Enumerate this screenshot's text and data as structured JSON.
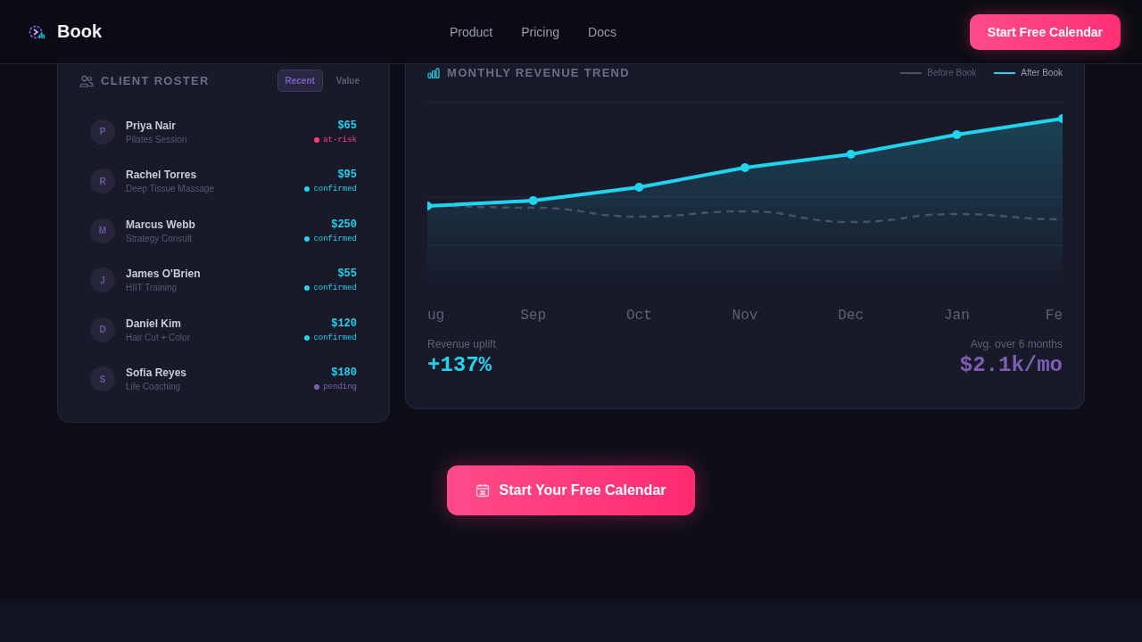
{
  "brand": {
    "name": "Book"
  },
  "nav": [
    {
      "label": "Product"
    },
    {
      "label": "Pricing"
    },
    {
      "label": "Docs"
    }
  ],
  "header_cta": "Start Free Calendar",
  "roster": {
    "title": "CLIENT ROSTER",
    "sort_tabs": [
      {
        "label": "Recent",
        "selected": true
      },
      {
        "label": "Value",
        "selected": false
      }
    ],
    "clients": [
      {
        "initial": "P",
        "name": "Priya Nair",
        "service": "Pilates Session",
        "amount": "$65",
        "status": "at-risk",
        "color": "#ff3d7f"
      },
      {
        "initial": "R",
        "name": "Rachel Torres",
        "service": "Deep Tissue Massage",
        "amount": "$95",
        "status": "confirmed",
        "color": "#22d3ee"
      },
      {
        "initial": "M",
        "name": "Marcus Webb",
        "service": "Strategy Consult",
        "amount": "$250",
        "status": "confirmed",
        "color": "#22d3ee"
      },
      {
        "initial": "J",
        "name": "James O'Brien",
        "service": "HIIT Training",
        "amount": "$55",
        "status": "confirmed",
        "color": "#22d3ee"
      },
      {
        "initial": "D",
        "name": "Daniel Kim",
        "service": "Hair Cut + Color",
        "amount": "$120",
        "status": "confirmed",
        "color": "#22d3ee"
      },
      {
        "initial": "S",
        "name": "Sofia Reyes",
        "service": "Life Coaching",
        "amount": "$180",
        "status": "pending",
        "color": "#7c5fb5"
      }
    ]
  },
  "revenue": {
    "title": "MONTHLY REVENUE TREND",
    "legend": [
      {
        "label": "Before Book",
        "kind": "dashed"
      },
      {
        "label": "After Book",
        "kind": "solid"
      }
    ],
    "x_labels": [
      "ug",
      "Sep",
      "Oct",
      "Nov",
      "Dec",
      "Jan",
      "Fe"
    ],
    "stats": [
      {
        "label": "Revenue uplift",
        "value": "+137%",
        "kind": "uplift"
      },
      {
        "label": "Avg. over 6 months",
        "value": "$2.1k/mo",
        "kind": "average"
      }
    ]
  },
  "cta": "Start Your Free Calendar"
}
